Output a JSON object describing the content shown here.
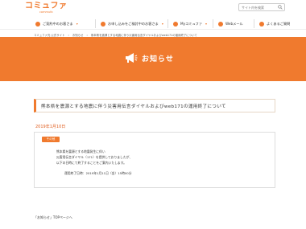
{
  "header": {
    "logo_main": "コミュファ",
    "logo_sub": "commufa",
    "search_placeholder": "サイト内を検索"
  },
  "nav": {
    "items": [
      {
        "label": "ご契約中のお客さま",
        "arrow": "▾"
      },
      {
        "label": "お申し込みをご検討中のお客さま",
        "arrow": "▾"
      },
      {
        "label": "Myコミュファ",
        "arrow": "▾"
      },
      {
        "label": "Webメール",
        "arrow": ""
      },
      {
        "label": "よくあるご質問",
        "arrow": ""
      }
    ]
  },
  "breadcrumb": {
    "items": [
      "コミュファ光 公式サイト",
      "›",
      "お知らせ",
      "›",
      "熊本県を震源とする地震に伴う災害用伝言ダイヤルおよびweb171の運用終了について"
    ]
  },
  "banner": {
    "title": "お知らせ"
  },
  "notice": {
    "title": "熊本県を震源とする地震に伴う災害用伝言ダイヤルおよびweb171の運用終了について",
    "date": "2019年1月10日",
    "tag": "その他",
    "lines": [
      "熊本県を震源とする地震発生に伴い",
      "災害用伝言ダイヤル（171）を提供しておりましたが、",
      "以下の日時にて終了することをご案内いたします。",
      "運用終了日時：2019年1月11日（金）15時00分"
    ]
  },
  "footer": {
    "link_text": "「お知らせ」TOPページへ"
  },
  "colors": {
    "accent": "#f07a2e",
    "date": "#e05c1c"
  }
}
